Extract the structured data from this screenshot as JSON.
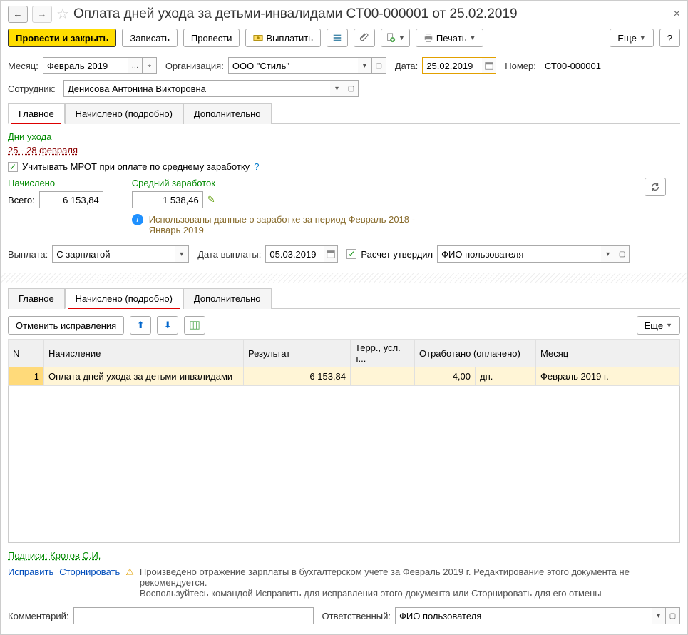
{
  "header": {
    "title": "Оплата дней ухода за детьми-инвалидами СТ00-000001 от 25.02.2019"
  },
  "toolbar": {
    "post_close": "Провести и закрыть",
    "save": "Записать",
    "post": "Провести",
    "pay": "Выплатить",
    "print": "Печать",
    "more": "Еще",
    "help": "?"
  },
  "form": {
    "month_label": "Месяц:",
    "month_value": "Февраль 2019",
    "org_label": "Организация:",
    "org_value": "ООО \"Стиль\"",
    "date_label": "Дата:",
    "date_value": "25.02.2019",
    "number_label": "Номер:",
    "number_value": "СТ00-000001",
    "employee_label": "Сотрудник:",
    "employee_value": "Денисова Антонина Викторовна"
  },
  "tabs1": {
    "main": "Главное",
    "details": "Начислено (подробно)",
    "extra": "Дополнительно"
  },
  "main_tab": {
    "days_header": "Дни ухода",
    "days_range": "25 - 28 февраля",
    "mrot_check": "Учитывать МРОТ при оплате по среднему заработку",
    "accrued_header": "Начислено",
    "total_label": "Всего:",
    "total_value": "6 153,84",
    "avg_header": "Средний заработок",
    "avg_value": "1 538,46",
    "info_text": "Использованы данные о заработке за период Февраль 2018 - Январь 2019",
    "pay_label": "Выплата:",
    "pay_value": "С зарплатой",
    "pay_date_label": "Дата выплаты:",
    "pay_date_value": "05.03.2019",
    "approved_label": "Расчет утвердил",
    "approved_by": "ФИО пользователя"
  },
  "tabs2": {
    "main": "Главное",
    "details": "Начислено (подробно)",
    "extra": "Дополнительно"
  },
  "details_bar": {
    "cancel_fix": "Отменить исправления",
    "more": "Еще"
  },
  "table": {
    "col_n": "N",
    "col_accrual": "Начисление",
    "col_result": "Результат",
    "col_terr": "Терр., усл. т...",
    "col_worked": "Отработано (оплачено)",
    "col_month": "Месяц",
    "row": {
      "n": "1",
      "accrual": "Оплата дней ухода за детьми-инвалидами",
      "result": "6 153,84",
      "worked_val": "4,00",
      "worked_unit": "дн.",
      "month": "Февраль 2019 г."
    }
  },
  "footer": {
    "signatures": "Подписи: Кротов С.И.",
    "fix": "Исправить",
    "storno": "Сторнировать",
    "warning1": "Произведено отражение зарплаты в бухгалтерском учете за Февраль 2019 г. Редактирование этого документа не рекомендуется.",
    "warning2": "Воспользуйтесь командой Исправить для исправления этого документа или Сторнировать для его отмены",
    "comment_label": "Комментарий:",
    "responsible_label": "Ответственный:",
    "responsible_value": "ФИО пользователя"
  }
}
